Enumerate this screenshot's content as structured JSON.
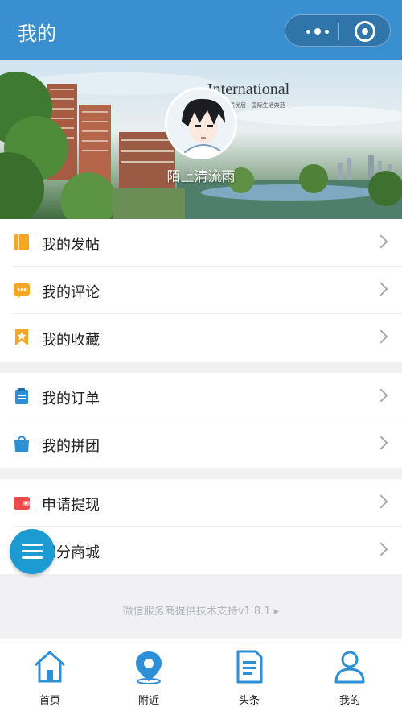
{
  "navbar": {
    "title": "我的",
    "more_icon": "more-dots-icon",
    "close_icon": "target-circle-icon"
  },
  "banner": {
    "brand": "International",
    "tagline": "品质优居 · 国际生活典范",
    "user_name": "陌上清流雨"
  },
  "menu_groups": [
    [
      {
        "label": "我的发帖",
        "icon": "notebook-icon",
        "color": "#f5a623"
      },
      {
        "label": "我的评论",
        "icon": "comment-icon",
        "color": "#f5a623"
      },
      {
        "label": "我的收藏",
        "icon": "bookmark-icon",
        "color": "#f5a623"
      }
    ],
    [
      {
        "label": "我的订单",
        "icon": "clipboard-icon",
        "color": "#2d8fd5"
      },
      {
        "label": "我的拼团",
        "icon": "shopping-bag-icon",
        "color": "#2d8fd5"
      }
    ],
    [
      {
        "label": "申请提现",
        "icon": "wallet-icon",
        "color": "#e94b4b"
      },
      {
        "label": "积分商城",
        "icon": "gift-icon",
        "color": "#2d8fd5"
      }
    ]
  ],
  "fab": {
    "icon": "menu-icon",
    "color": "#1b9bd2"
  },
  "support_text": "微信服务商提供技术支持v1.8.1 ▸",
  "tabbar": [
    {
      "label": "首页",
      "icon": "home-icon"
    },
    {
      "label": "附近",
      "icon": "location-pin-icon"
    },
    {
      "label": "头条",
      "icon": "document-icon"
    },
    {
      "label": "我的",
      "icon": "user-icon"
    }
  ],
  "colors": {
    "primary": "#3a8fd0",
    "accent_orange": "#f5a623",
    "accent_red": "#e94b4b",
    "tab_icon": "#2d8fd5"
  }
}
